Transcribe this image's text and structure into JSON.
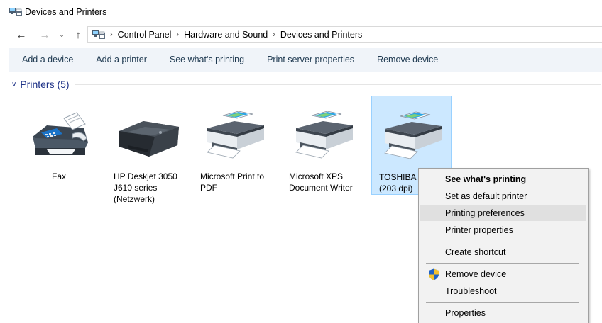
{
  "window": {
    "title": "Devices and Printers",
    "icon": "devices-and-printers-icon"
  },
  "address_bar": {
    "back_icon": "←",
    "forward_icon": "→",
    "recent_icon": "⌄",
    "up_icon": "↑",
    "breadcrumbs": [
      "Control Panel",
      "Hardware and Sound",
      "Devices and Printers"
    ],
    "separator": "›"
  },
  "command_bar": {
    "items": [
      "Add a device",
      "Add a printer",
      "See what's printing",
      "Print server properties",
      "Remove device"
    ]
  },
  "group": {
    "chevron": "∨",
    "label": "Printers (5)",
    "color": "#1e3287"
  },
  "devices": [
    {
      "name": "Fax",
      "icon": "fax-icon"
    },
    {
      "name": "HP Deskjet 3050 J610 series (Netzwerk)",
      "icon": "inkjet-printer-icon"
    },
    {
      "name": "Microsoft Print to PDF",
      "icon": "printer-icon"
    },
    {
      "name": "Microsoft XPS Document Writer",
      "icon": "printer-icon"
    },
    {
      "name": "TOSHIBA (203 dpi)",
      "icon": "printer-icon",
      "selected": true
    }
  ],
  "context_menu": {
    "items": [
      {
        "label": "See what's printing",
        "bold": true
      },
      {
        "label": "Set as default printer"
      },
      {
        "label": "Printing preferences",
        "highlighted": true
      },
      {
        "label": "Printer properties"
      },
      {
        "label": "Create shortcut"
      },
      {
        "label": "Remove device",
        "icon": "uac-shield-icon"
      },
      {
        "label": "Troubleshoot"
      },
      {
        "label": "Properties"
      }
    ]
  },
  "colors": {
    "selection": "#cce8ff",
    "selection_border": "#99d1ff",
    "command_bar_bg": "#f0f4f9",
    "menu_bg": "#f2f2f2"
  }
}
